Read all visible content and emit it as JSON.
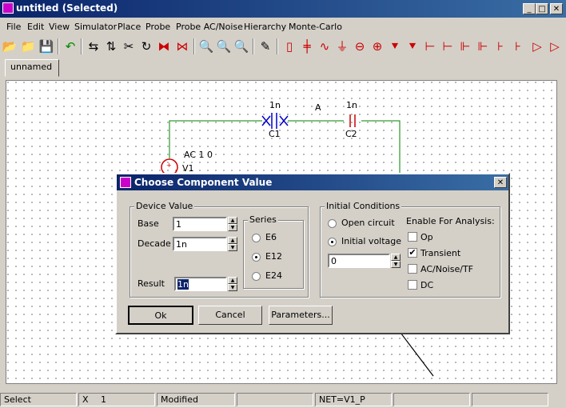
{
  "window": {
    "title": "untitled (Selected)"
  },
  "menu": [
    "File",
    "Edit",
    "View",
    "Simulator",
    "Place",
    "Probe",
    "Probe AC/Noise",
    "Hierarchy",
    "Monte-Carlo"
  ],
  "tab": {
    "label": "unnamed"
  },
  "schematic": {
    "c1_value": "1n",
    "c1_name": "C1",
    "c2_value": "1n",
    "c2_name": "C2",
    "node_label": "A",
    "source_params": "AC 1 0",
    "source_name": "V1"
  },
  "dialog": {
    "title": "Choose Component Value",
    "device_value_label": "Device Value",
    "base_label": "Base",
    "base_value": "1",
    "decade_label": "Decade",
    "decade_value": "1n",
    "result_label": "Result",
    "result_value": "1n",
    "series_label": "Series",
    "series_options": [
      "E6",
      "E12",
      "E24"
    ],
    "series_selected": "E12",
    "initial_conditions_label": "Initial Conditions",
    "open_circuit_label": "Open circuit",
    "initial_voltage_label": "Initial voltage",
    "initial_voltage_selected": true,
    "initial_voltage_value": "0",
    "enable_label": "Enable For Analysis:",
    "analysis": [
      {
        "label": "Op",
        "checked": false
      },
      {
        "label": "Transient",
        "checked": true
      },
      {
        "label": "AC/Noise/TF",
        "checked": false
      },
      {
        "label": "DC",
        "checked": false
      }
    ],
    "ok_label": "Ok",
    "cancel_label": "Cancel",
    "parameters_label": "Parameters..."
  },
  "status": {
    "mode": "Select",
    "x_label": "X",
    "x_value": "1",
    "modified": "Modified",
    "net": "NET=V1_P"
  }
}
